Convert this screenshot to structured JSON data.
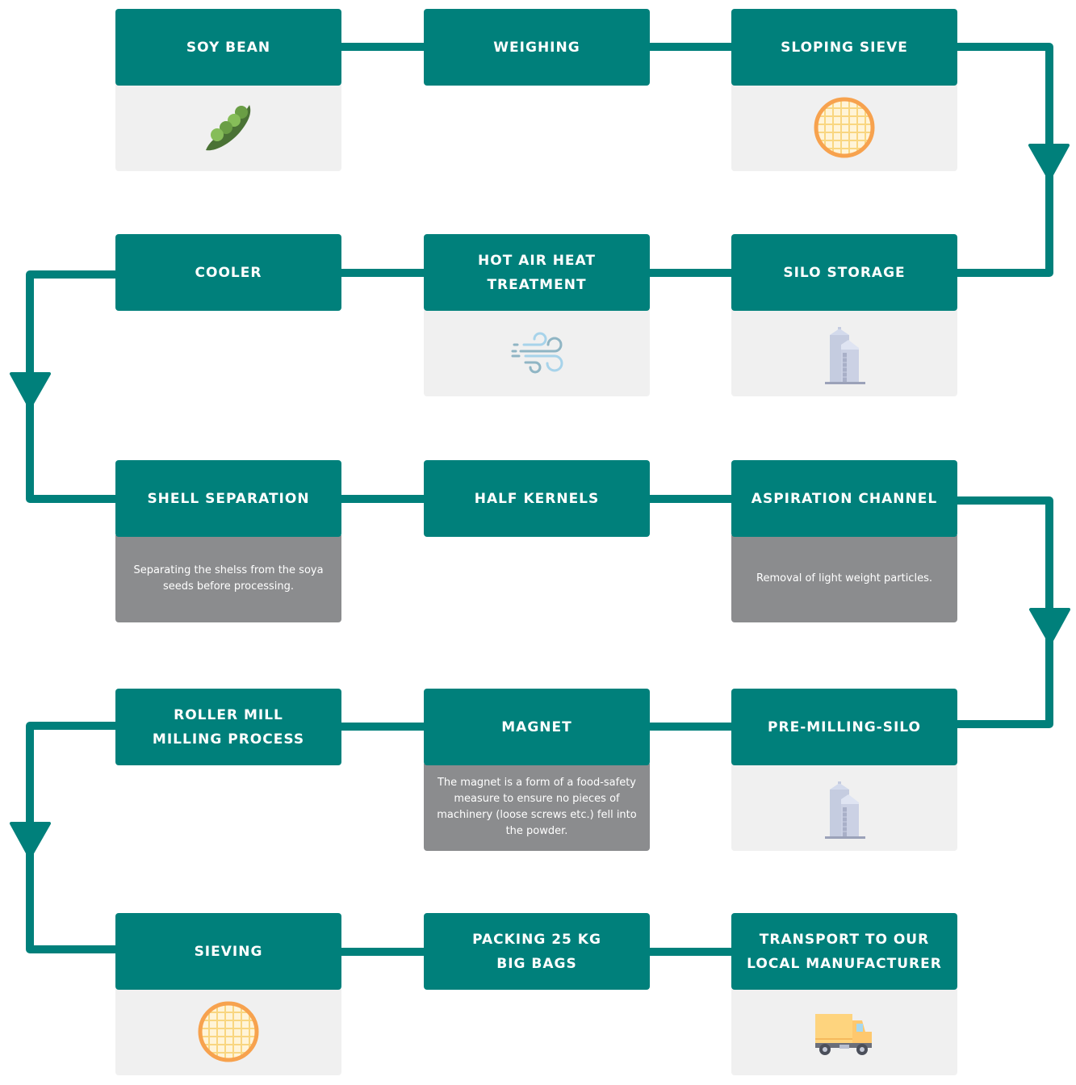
{
  "diagram": {
    "type": "process-flow",
    "colors": {
      "header": "#00807b",
      "connector": "#00807b",
      "icon_panel": "#f0f0f0",
      "description_panel": "#8b8c8e",
      "text_light": "#ffffff"
    },
    "steps": [
      {
        "id": 1,
        "title": "SOY BEAN",
        "icon": "pea-pod-icon",
        "description": null
      },
      {
        "id": 2,
        "title": "WEIGHING",
        "icon": null,
        "description": null
      },
      {
        "id": 3,
        "title": "SLOPING SIEVE",
        "icon": "sieve-icon",
        "description": null
      },
      {
        "id": 4,
        "title": "SILO STORAGE",
        "icon": "silo-icon",
        "description": null
      },
      {
        "id": 5,
        "title": "HOT AIR HEAT\nTREATMENT",
        "icon": "wind-icon",
        "description": null
      },
      {
        "id": 6,
        "title": "COOLER",
        "icon": null,
        "description": null
      },
      {
        "id": 7,
        "title": "SHELL SEPARATION",
        "icon": null,
        "description": "Separating the shelss from the soya seeds before processing."
      },
      {
        "id": 8,
        "title": "HALF KERNELS",
        "icon": null,
        "description": null
      },
      {
        "id": 9,
        "title": "ASPIRATION CHANNEL",
        "icon": null,
        "description": "Removal of light weight particles."
      },
      {
        "id": 10,
        "title": "PRE-MILLING-SILO",
        "icon": "silo-icon",
        "description": null
      },
      {
        "id": 11,
        "title": "MAGNET",
        "icon": null,
        "description": "The magnet is a form of a food-safety measure to ensure no pieces of machinery (loose screws etc.) fell into the powder."
      },
      {
        "id": 12,
        "title": "ROLLER MILL\nMILLING PROCESS",
        "icon": null,
        "description": null
      },
      {
        "id": 13,
        "title": "SIEVING",
        "icon": "sieve-icon",
        "description": null
      },
      {
        "id": 14,
        "title": "PACKING 25 KG\nBIG BAGS",
        "icon": null,
        "description": null
      },
      {
        "id": 15,
        "title": "TRANSPORT TO OUR\nLOCAL MANUFACTURER",
        "icon": "truck-icon",
        "description": null
      }
    ],
    "flow": "serpentine: row 1 left-to-right, row 2 right-to-left, row 3 left-to-right, row 4 right-to-left, row 5 left-to-right"
  }
}
